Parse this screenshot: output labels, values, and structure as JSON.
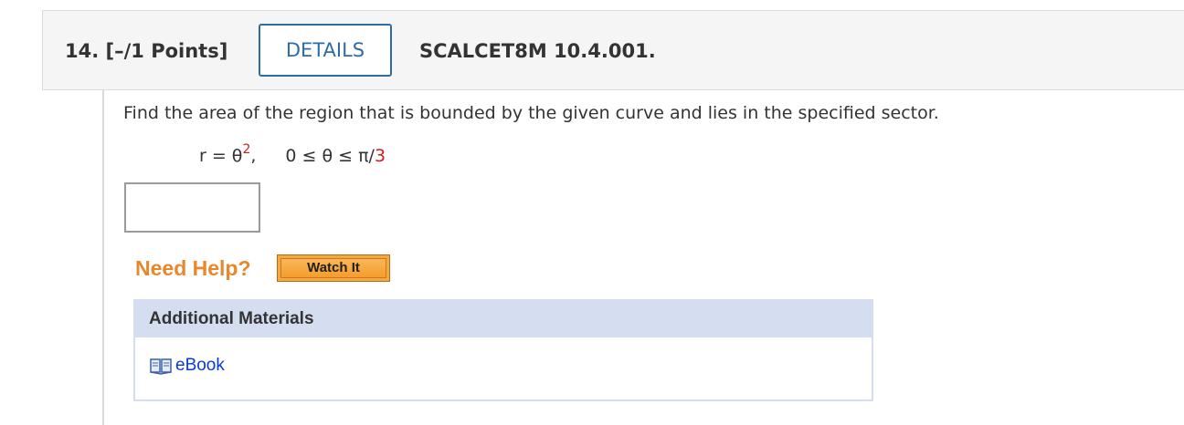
{
  "question": {
    "number_label": "14.",
    "points_label": "[–/1 Points]",
    "details_label": "DETAILS",
    "code": "SCALCET8M 10.4.001."
  },
  "prompt": "Find the area of the region that is bounded by the given curve and lies in the specified sector.",
  "equation": {
    "lhs": "r = θ",
    "exponent": "2",
    "comma": ",",
    "bounds_left": "0 ≤ θ ≤ π/",
    "bounds_upper": "3"
  },
  "answer": {
    "value": ""
  },
  "help": {
    "title": "Need Help?",
    "watch_label": "Watch It"
  },
  "materials": {
    "header": "Additional Materials",
    "items": [
      {
        "label": "eBook",
        "icon": "book-icon"
      }
    ]
  },
  "colors": {
    "accent_blue": "#2e6da4",
    "red_values": "#cc1e1e",
    "help_orange": "#e8872c",
    "materials_header_bg": "#d5def1",
    "link_blue": "#0a3bd1"
  }
}
